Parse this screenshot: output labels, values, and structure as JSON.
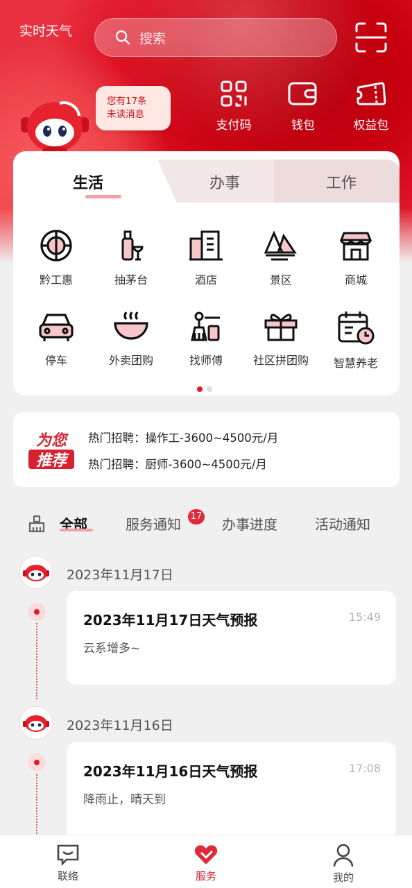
{
  "header": {
    "weather_label": "实时天气",
    "search_placeholder": "搜索",
    "unread_bubble_line1": "您有17条",
    "unread_bubble_line2": "未读消息",
    "quick_actions": [
      {
        "label": "支付码",
        "icon": "qr-code-icon"
      },
      {
        "label": "钱包",
        "icon": "wallet-icon"
      },
      {
        "label": "权益包",
        "icon": "ticket-icon"
      }
    ]
  },
  "tabs": [
    {
      "label": "生活",
      "active": true
    },
    {
      "label": "办事",
      "active": false
    },
    {
      "label": "工作",
      "active": false
    }
  ],
  "services": [
    {
      "label": "黔工惠",
      "icon": "union-badge-icon"
    },
    {
      "label": "抽茅台",
      "icon": "liquor-bottle-icon"
    },
    {
      "label": "酒店",
      "icon": "hotel-building-icon"
    },
    {
      "label": "景区",
      "icon": "scenic-mountain-icon"
    },
    {
      "label": "商城",
      "icon": "shop-icon"
    },
    {
      "label": "停车",
      "icon": "car-icon"
    },
    {
      "label": "外卖团购",
      "icon": "food-bowl-icon"
    },
    {
      "label": "找师傅",
      "icon": "cleaning-tools-icon"
    },
    {
      "label": "社区拼团购",
      "icon": "gift-box-icon"
    },
    {
      "label": "智慧养老",
      "icon": "calendar-clock-icon"
    }
  ],
  "pager": {
    "total": 2,
    "current": 1
  },
  "jobs": {
    "logo_line1": "为您",
    "logo_line2": "推荐",
    "items": [
      "热门招聘：操作工-3600~4500元/月",
      "热门招聘：厨师-3600~4500元/月"
    ]
  },
  "filters": [
    {
      "label": "全部",
      "active": true
    },
    {
      "label": "服务通知",
      "active": false,
      "badge": "17"
    },
    {
      "label": "办事进度",
      "active": false
    },
    {
      "label": "活动通知",
      "active": false
    }
  ],
  "messages": [
    {
      "date": "2023年11月17日",
      "title": "2023年11月17日天气预报",
      "time": "15:49",
      "body": "云系增多~"
    },
    {
      "date": "2023年11月16日",
      "title": "2023年11月16日天气预报",
      "time": "17:08",
      "body": "降雨止，晴天到"
    }
  ],
  "bottom_nav": [
    {
      "label": "联络",
      "icon": "chat-box-icon",
      "active": false
    },
    {
      "label": "服务",
      "icon": "service-heart-icon",
      "active": true
    },
    {
      "label": "我的",
      "icon": "person-icon",
      "active": false
    }
  ],
  "colors": {
    "brand_red": "#d8212f",
    "accent_pink": "#f0a0a6"
  }
}
